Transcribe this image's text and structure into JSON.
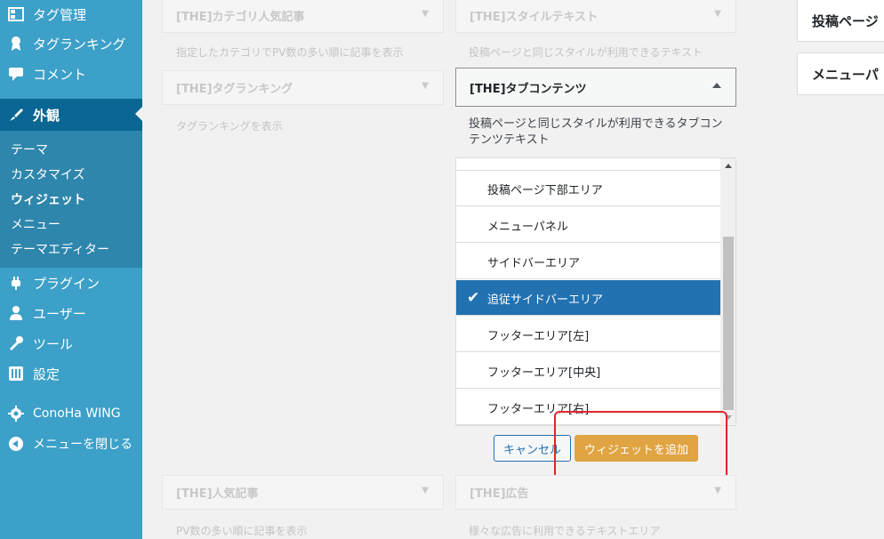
{
  "sidebar": {
    "top_items": [
      {
        "label": "タグ管理",
        "icon": "grid-icon"
      },
      {
        "label": "タグランキング",
        "icon": "award-icon"
      },
      {
        "label": "コメント",
        "icon": "comment-icon"
      }
    ],
    "current": {
      "label": "外観",
      "icon": "brush-icon"
    },
    "submenu": [
      "テーマ",
      "カスタマイズ",
      "ウィジェット",
      "メニュー",
      "テーマエディター"
    ],
    "active_sub": "ウィジェット",
    "bottom_items": [
      {
        "label": "プラグイン",
        "icon": "plugin-icon"
      },
      {
        "label": "ユーザー",
        "icon": "user-icon"
      },
      {
        "label": "ツール",
        "icon": "wrench-icon"
      },
      {
        "label": "設定",
        "icon": "settings-icon"
      },
      {
        "label": "ConoHa WING",
        "icon": "gear-icon"
      },
      {
        "label": "メニューを閉じる",
        "icon": "collapse-icon"
      }
    ]
  },
  "widgets": {
    "category_popular": {
      "title": "[THE]カテゴリ人気記事",
      "desc": "指定したカテゴリでPV数の多い順に記事を表示"
    },
    "style_text": {
      "title": "[THE]スタイルテキスト",
      "desc": "投稿ページと同じスタイルが利用できるテキスト"
    },
    "tag_ranking": {
      "title": "[THE]タグランキング",
      "desc": "タグランキングを表示"
    },
    "tab_contents": {
      "title": "[THE]タブコンテンツ",
      "desc": "投稿ページと同じスタイルが利用できるタブコンテンツテキスト"
    },
    "popular": {
      "title": "[THE]人気記事",
      "desc": "PV数の多い順に記事を表示"
    },
    "ad": {
      "title": "[THE]広告",
      "desc": "様々な広告に利用できるテキストエリア"
    }
  },
  "chooser": {
    "items": [
      "投稿ページ下部エリア",
      "メニューパネル",
      "サイドバーエリア",
      "追従サイドバーエリア",
      "フッターエリア[左]",
      "フッターエリア[中央]",
      "フッターエリア[右]"
    ],
    "selected": "追従サイドバーエリア"
  },
  "buttons": {
    "cancel": "キャンセル",
    "add": "ウィジェットを追加"
  },
  "right_areas": [
    "投稿ページ",
    "メニューパ"
  ],
  "colors": {
    "sidebar": "#3ca0c8",
    "current": "#0a6693",
    "selected": "#2271b1",
    "add_button": "#e0a442",
    "highlight": "#e0242b"
  }
}
